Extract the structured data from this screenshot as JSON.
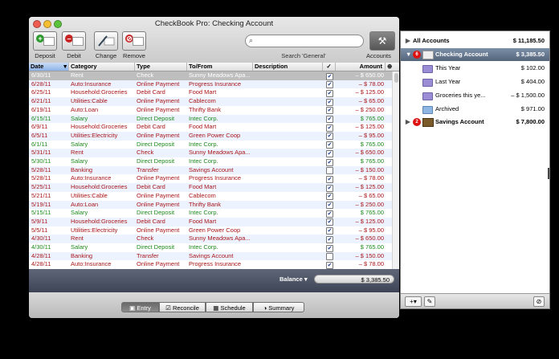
{
  "window": {
    "title": "CheckBook Pro:  Checking Account"
  },
  "toolbar": {
    "deposit_label": "Deposit",
    "debit_label": "Debit",
    "change_label": "Change",
    "remove_label": "Remove",
    "search_placeholder": "",
    "search_label": "Search 'General'",
    "accounts_label": "Accounts"
  },
  "columns": {
    "date": "Date",
    "category": "Category",
    "type": "Type",
    "tofrom": "To/From",
    "description": "Description",
    "cleared": "✓",
    "amount": "Amount"
  },
  "rows": [
    {
      "date": "6/30/11",
      "category": "Rent",
      "type": "Check",
      "tofrom": "Sunny Meadows Apa...",
      "cleared": true,
      "amount": "– $ 650.00",
      "kind": "debit"
    },
    {
      "date": "6/28/11",
      "category": "Auto:Insurance",
      "type": "Online Payment",
      "tofrom": "Progress Insurance",
      "cleared": true,
      "amount": "– $ 78.00",
      "kind": "debit"
    },
    {
      "date": "6/25/11",
      "category": "Household:Groceries",
      "type": "Debit Card",
      "tofrom": "Food Mart",
      "cleared": true,
      "amount": "– $ 125.00",
      "kind": "debit"
    },
    {
      "date": "6/21/11",
      "category": "Utilities:Cable",
      "type": "Online Payment",
      "tofrom": "Cablecom",
      "cleared": true,
      "amount": "– $ 65.00",
      "kind": "debit"
    },
    {
      "date": "6/19/11",
      "category": "Auto:Loan",
      "type": "Online Payment",
      "tofrom": "Thrifty Bank",
      "cleared": true,
      "amount": "– $ 250.00",
      "kind": "debit"
    },
    {
      "date": "6/15/11",
      "category": "Salary",
      "type": "Direct Deposit",
      "tofrom": "Intec Corp.",
      "cleared": true,
      "amount": "$ 765.00",
      "kind": "credit"
    },
    {
      "date": "6/9/11",
      "category": "Household:Groceries",
      "type": "Debit Card",
      "tofrom": "Food Mart",
      "cleared": true,
      "amount": "– $ 125.00",
      "kind": "debit"
    },
    {
      "date": "6/5/11",
      "category": "Utilities:Electricity",
      "type": "Online Payment",
      "tofrom": "Green Power Coop",
      "cleared": true,
      "amount": "– $ 95.00",
      "kind": "debit"
    },
    {
      "date": "6/1/11",
      "category": "Salary",
      "type": "Direct Deposit",
      "tofrom": "Intec Corp.",
      "cleared": true,
      "amount": "$ 765.00",
      "kind": "credit"
    },
    {
      "date": "5/31/11",
      "category": "Rent",
      "type": "Check",
      "tofrom": "Sunny Meadows Apa...",
      "cleared": true,
      "amount": "– $ 650.00",
      "kind": "debit"
    },
    {
      "date": "5/30/11",
      "category": "Salary",
      "type": "Direct Deposit",
      "tofrom": "Intec Corp.",
      "cleared": true,
      "amount": "$ 765.00",
      "kind": "credit"
    },
    {
      "date": "5/28/11",
      "category": "Banking",
      "type": "Transfer",
      "tofrom": "Savings Account",
      "cleared": false,
      "amount": "– $ 150.00",
      "kind": "debit"
    },
    {
      "date": "5/28/11",
      "category": "Auto:Insurance",
      "type": "Online Payment",
      "tofrom": "Progress Insurance",
      "cleared": true,
      "amount": "– $ 78.00",
      "kind": "debit"
    },
    {
      "date": "5/25/11",
      "category": "Household:Groceries",
      "type": "Debit Card",
      "tofrom": "Food Mart",
      "cleared": true,
      "amount": "– $ 125.00",
      "kind": "debit"
    },
    {
      "date": "5/21/11",
      "category": "Utilities:Cable",
      "type": "Online Payment",
      "tofrom": "Cablecom",
      "cleared": true,
      "amount": "– $ 65.00",
      "kind": "debit"
    },
    {
      "date": "5/19/11",
      "category": "Auto:Loan",
      "type": "Online Payment",
      "tofrom": "Thrifty Bank",
      "cleared": true,
      "amount": "– $ 250.00",
      "kind": "debit"
    },
    {
      "date": "5/15/11",
      "category": "Salary",
      "type": "Direct Deposit",
      "tofrom": "Intec Corp.",
      "cleared": true,
      "amount": "$ 765.00",
      "kind": "credit"
    },
    {
      "date": "5/9/11",
      "category": "Household:Groceries",
      "type": "Debit Card",
      "tofrom": "Food Mart",
      "cleared": true,
      "amount": "– $ 125.00",
      "kind": "debit"
    },
    {
      "date": "5/5/11",
      "category": "Utilities:Electricity",
      "type": "Online Payment",
      "tofrom": "Green Power Coop",
      "cleared": true,
      "amount": "– $ 95.00",
      "kind": "debit"
    },
    {
      "date": "4/30/11",
      "category": "Rent",
      "type": "Check",
      "tofrom": "Sunny Meadows Apa...",
      "cleared": true,
      "amount": "– $ 650.00",
      "kind": "debit"
    },
    {
      "date": "4/30/11",
      "category": "Salary",
      "type": "Direct Deposit",
      "tofrom": "Intec Corp.",
      "cleared": true,
      "amount": "$ 765.00",
      "kind": "credit"
    },
    {
      "date": "4/28/11",
      "category": "Banking",
      "type": "Transfer",
      "tofrom": "Savings Account",
      "cleared": false,
      "amount": "– $ 150.00",
      "kind": "debit"
    },
    {
      "date": "4/28/11",
      "category": "Auto:Insurance",
      "type": "Online Payment",
      "tofrom": "Progress Insurance",
      "cleared": true,
      "amount": "– $ 78.00",
      "kind": "debit"
    }
  ],
  "balance": {
    "label": "Balance ▾",
    "value": "$ 3,385.50"
  },
  "tabs": [
    {
      "label": "Entry",
      "active": true
    },
    {
      "label": "Reconcile",
      "active": false
    },
    {
      "label": "Schedule",
      "active": false
    },
    {
      "label": "Summary",
      "active": false
    }
  ],
  "accounts": {
    "all_label": "All Accounts",
    "all_value": "$ 11,185.50",
    "checking_label": "Checking Account",
    "checking_value": "$ 3,385.50",
    "checking_badge": "6",
    "items": [
      {
        "label": "This Year",
        "value": "$ 102.00"
      },
      {
        "label": "Last Year",
        "value": "$ 404.00"
      },
      {
        "label": "Groceries this ye...",
        "value": "– $ 1,500.00"
      },
      {
        "label": "Archived",
        "value": "$ 971.00"
      }
    ],
    "savings_label": "Savings Account",
    "savings_value": "$ 7,800.00",
    "savings_badge": "2"
  },
  "colors": {
    "debit": "#a8161a",
    "credit": "#1d8a1d",
    "row_alt": "#edf3fe",
    "selected_row": "#bebebe"
  }
}
